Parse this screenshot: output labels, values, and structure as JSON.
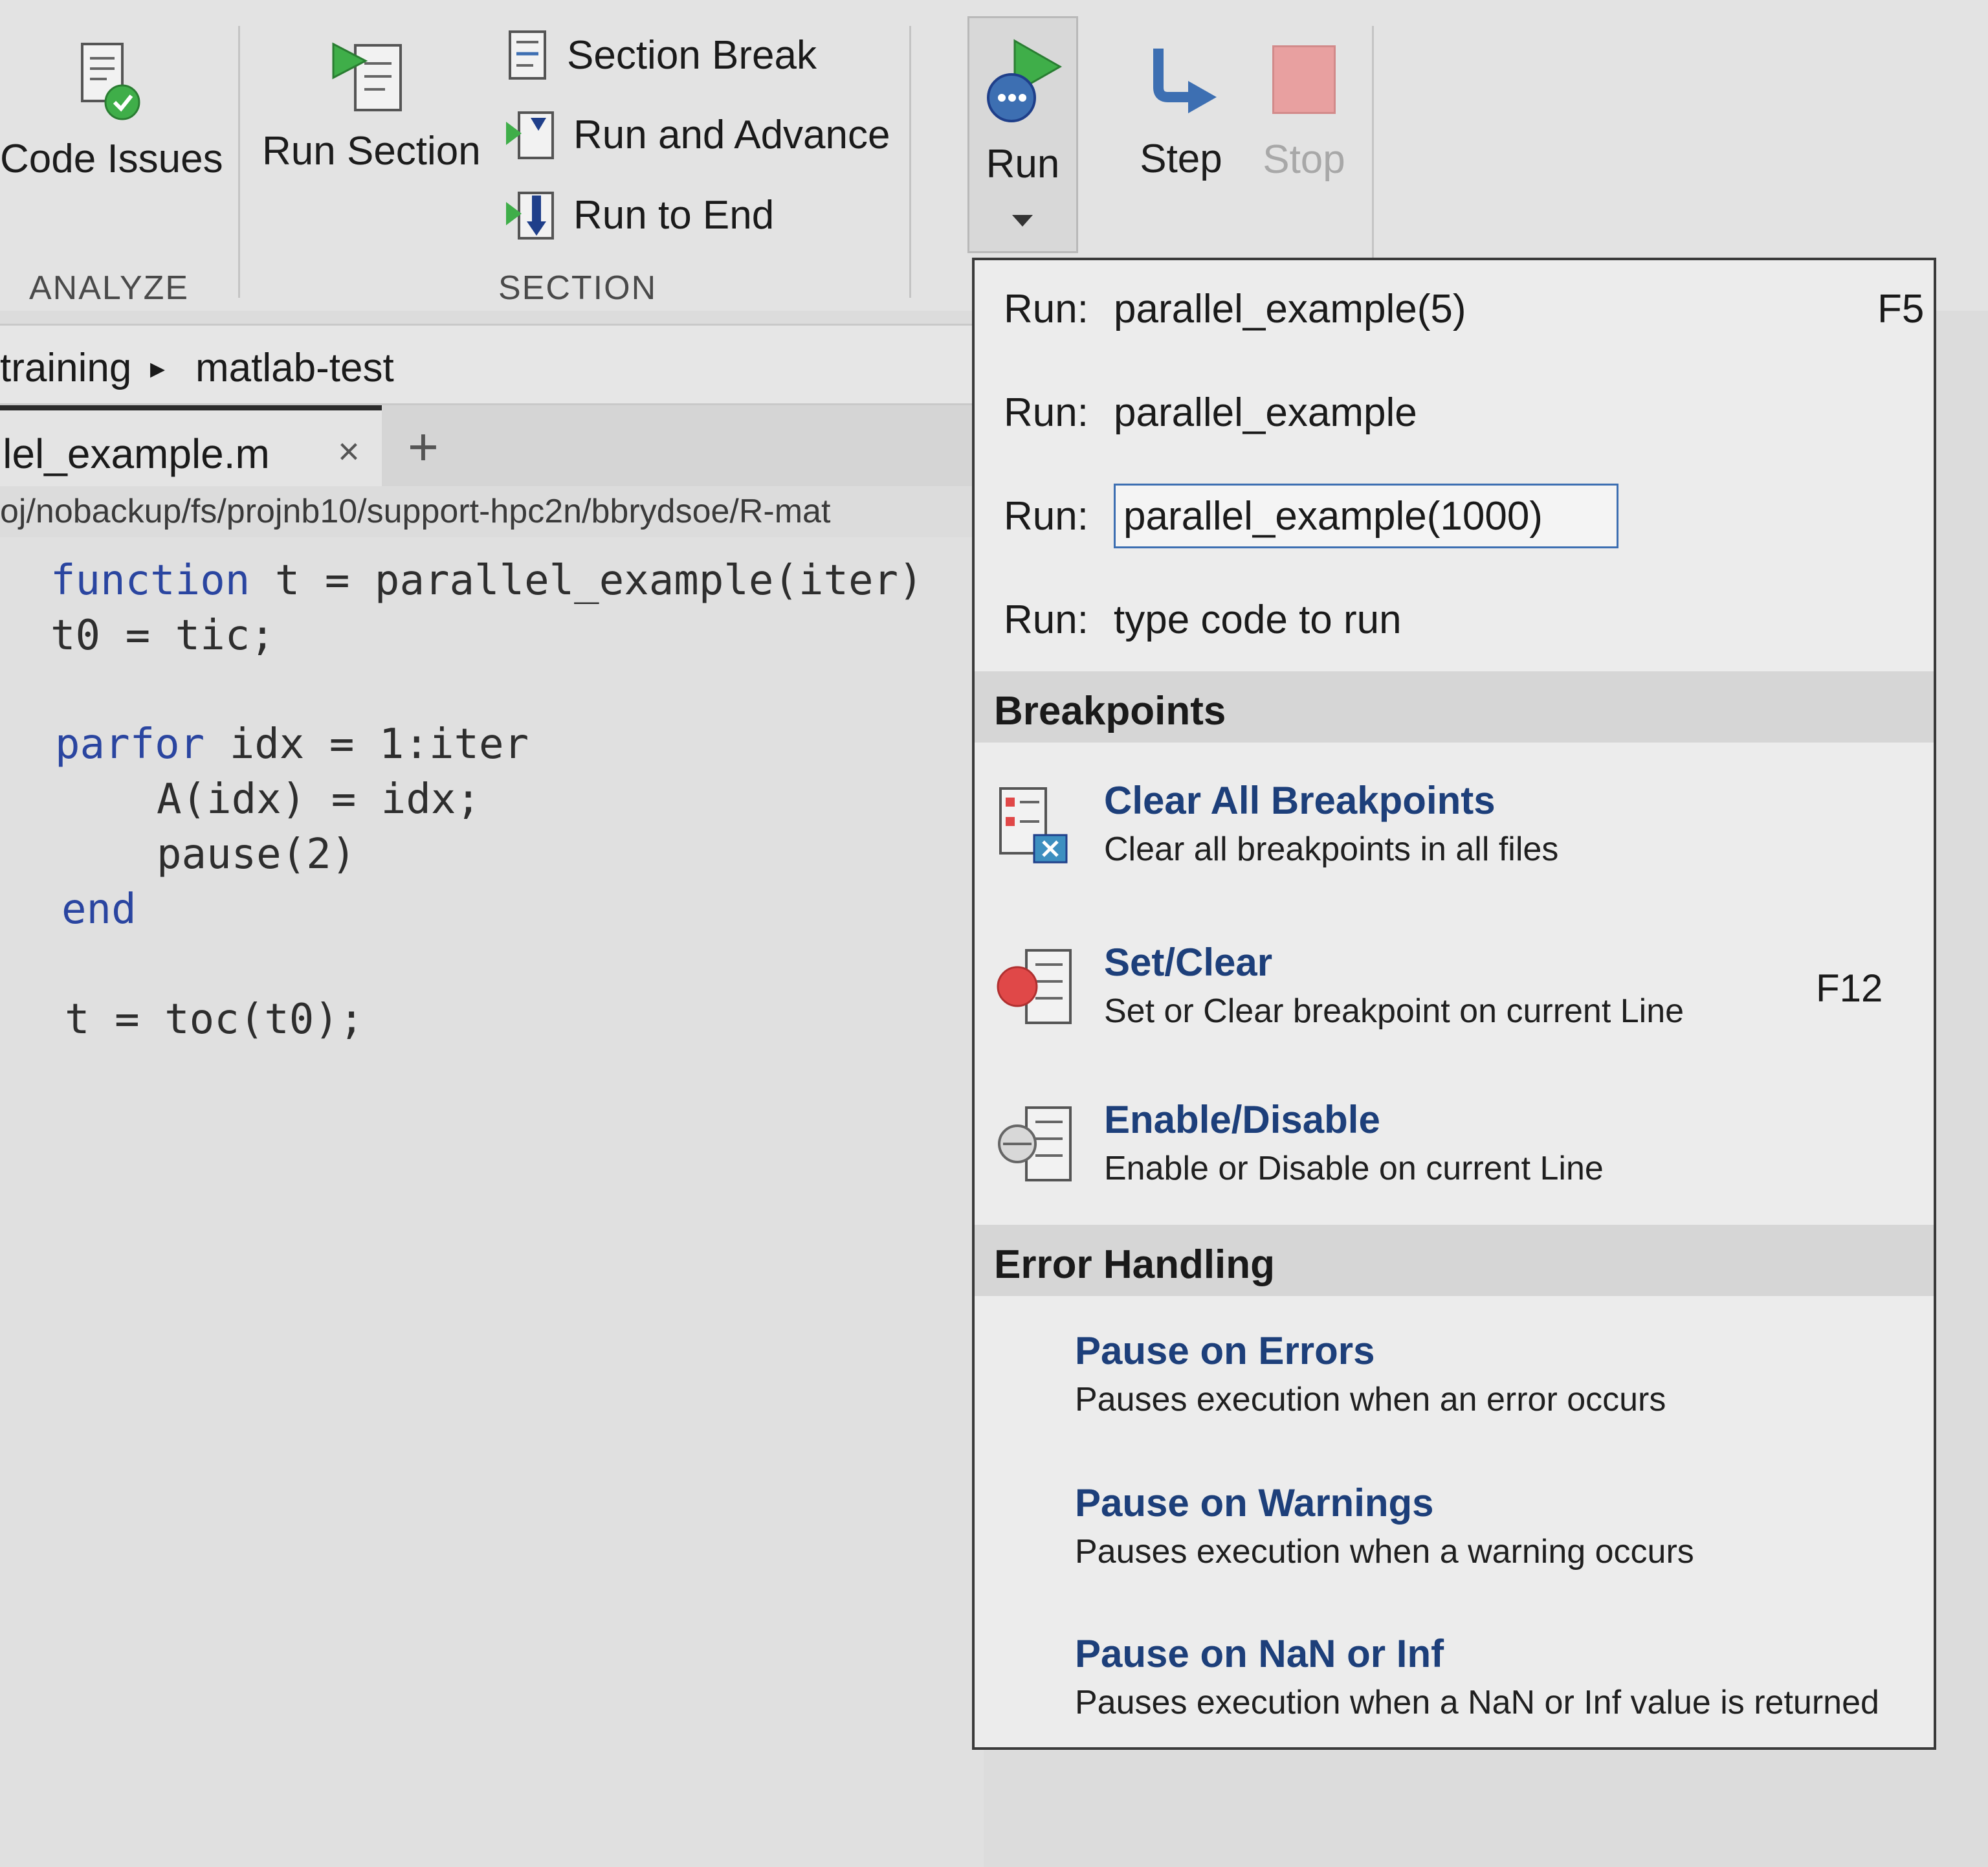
{
  "toolstrip": {
    "code_issues": "Code Issues",
    "run_section": "Run Section",
    "section_break": "Section Break",
    "run_and_advance": "Run and Advance",
    "run_to_end": "Run to End",
    "run": "Run",
    "step": "Step",
    "stop": "Stop",
    "group_analyze": "ANALYZE",
    "group_section": "SECTION"
  },
  "breadcrumb": {
    "part1": "training",
    "part2": "matlab-test"
  },
  "tab": {
    "name": "llel_example.m",
    "close": "×",
    "add": "+"
  },
  "filepath": "oj/nobackup/fs/projnb10/support-hpc2n/bbrydsoe/R-mat",
  "code": {
    "line1_kw": "function",
    "line1_rest": " t = parallel_example(iter)",
    "line2": "t0 = tic;",
    "line4_kw": "parfor",
    "line4_rest": " idx = 1:iter",
    "line5": "A(idx) = idx;",
    "line6": "pause(2)",
    "line7": "end",
    "line9": "t = toc(t0);"
  },
  "dropdown": {
    "run_prefix": "Run:",
    "run1": "parallel_example(5)",
    "run1_shortcut": "F5",
    "run2": "parallel_example",
    "run3_value": "parallel_example(1000)",
    "run4": "type code to run",
    "breakpoints_header": "Breakpoints",
    "clear_all_title": "Clear All Breakpoints",
    "clear_all_desc": "Clear all breakpoints in all files",
    "set_clear_title": "Set/Clear",
    "set_clear_desc": "Set or Clear breakpoint on current Line",
    "set_clear_shortcut": "F12",
    "enable_title": "Enable/Disable",
    "enable_desc": "Enable or Disable on current Line",
    "error_header": "Error Handling",
    "pause_errors_title": "Pause on Errors",
    "pause_errors_desc": "Pauses execution when an error occurs",
    "pause_warnings_title": "Pause on Warnings",
    "pause_warnings_desc": "Pauses execution when a warning occurs",
    "pause_nan_title": "Pause on NaN or Inf",
    "pause_nan_desc": "Pauses execution when a NaN or Inf value is returned"
  },
  "colors": {
    "keyword": "#2a45a0",
    "menu_title": "#1d3f7a",
    "input_border": "#3d6fb2",
    "breakpoint_red": "#e04848",
    "stop_pink": "#e8a0a0",
    "run_green": "#3fae49"
  }
}
